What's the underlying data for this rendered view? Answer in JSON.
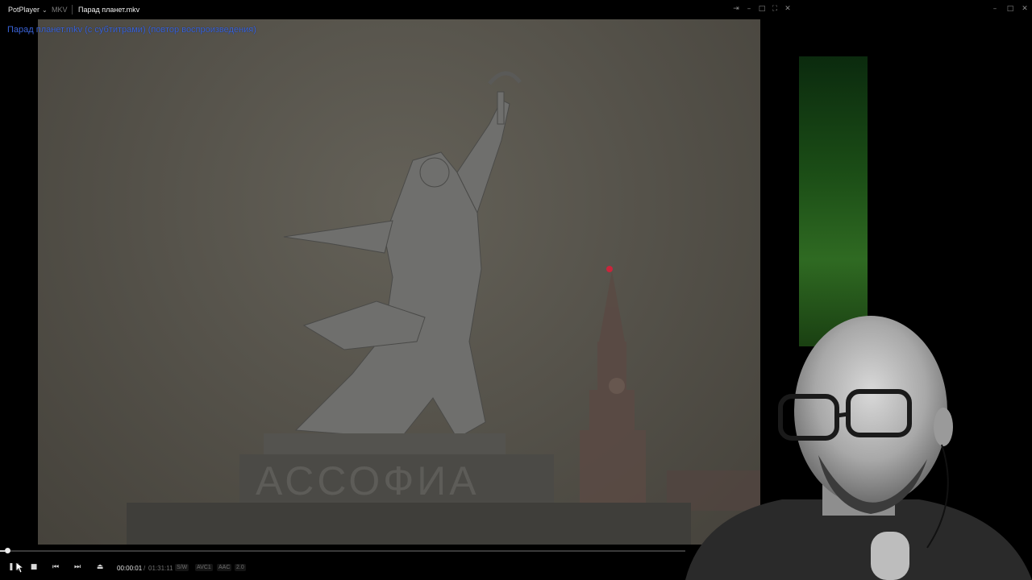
{
  "titlebar": {
    "app_name": "PotPlayer",
    "app_menu_icon": "chevron-down-icon",
    "format": "MKV",
    "file_name": "Парад планет.mkv",
    "controls": [
      "pin-icon",
      "minimize-icon",
      "maximize-icon",
      "fullscreen-icon",
      "close-icon"
    ],
    "window_controls": [
      "minimize-icon",
      "restore-icon",
      "close-icon"
    ]
  },
  "osd": {
    "message": "Парад планет.mkv (с субтитрами) (повтор воспроизведения)",
    "color": "#3a63d8"
  },
  "video": {
    "inscription": "АССОФИА"
  },
  "playback": {
    "progress": 0.0,
    "current_time": "00:00:01",
    "separator": "/",
    "total_time": "01:31:11",
    "tags": [
      "S/W",
      "AVC1",
      "AAC",
      "2.0"
    ]
  },
  "controls": [
    "pause-icon",
    "stop-icon",
    "previous-icon",
    "next-icon",
    "eject-icon"
  ],
  "colors": {
    "background": "#000000",
    "video_bg": "#56534b",
    "star": "#d6203a"
  }
}
